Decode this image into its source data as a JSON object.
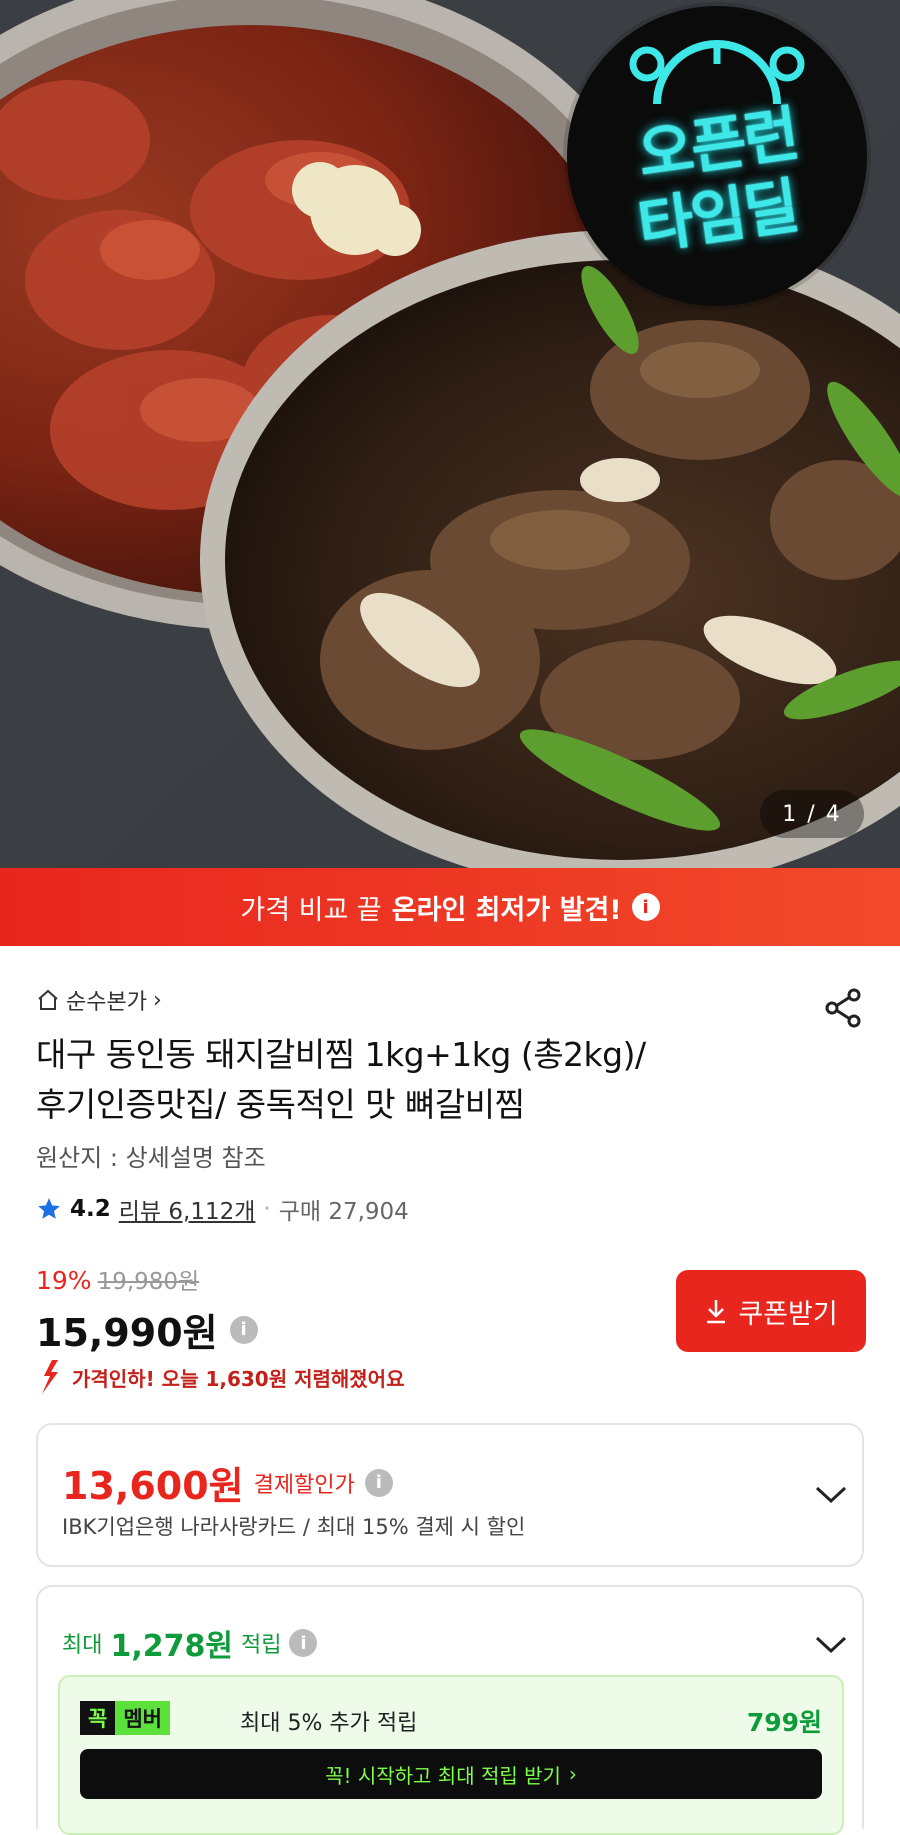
{
  "hero": {
    "badge_line1": "오픈런",
    "badge_line2": "타임딜",
    "pager": "1 / 4"
  },
  "banner": {
    "text_normal": "가격 비교 끝",
    "text_strong": "온라인 최저가 발견!",
    "info_glyph": "i"
  },
  "product": {
    "store_name": "순수본가",
    "store_chevron": "›",
    "title_line1": "대구 동인동 돼지갈비찜 1kg+1kg (총2kg)/",
    "title_line2": "후기인증맛집/ 중독적인 맛 뼈갈비찜",
    "origin": "원산지 : 상세설명 참조",
    "rating_score": "4.2",
    "review_label": "리뷰 6,112개",
    "separator": "·",
    "purchase_count": "구매 27,904"
  },
  "pricing": {
    "discount_pct": "19%",
    "original_price": "19,980원",
    "price": "15,990원",
    "price_info_glyph": "i",
    "coupon_label": "쿠폰받기",
    "price_drop_text": "가격인하! 오늘 1,630원 저렴해졌어요"
  },
  "payment_discount": {
    "amount": "13,600원",
    "label": "결제할인가",
    "info_glyph": "i",
    "description": "IBK기업은행 나라사랑카드 / 최대 15% 결제 시 할인"
  },
  "rewards": {
    "prefix": "최대",
    "amount": "1,278원",
    "suffix": "적립",
    "info_glyph": "i",
    "member_tag_1": "꼭",
    "member_tag_2": "멤버",
    "member_text": "최대 5% 추가 적립",
    "member_amount": "799원",
    "start_button": "꼭! 시작하고 최대 적립 받기",
    "start_chevron": "›"
  },
  "colors": {
    "accent_red": "#e8261e",
    "reward_green": "#0e9b3a",
    "neon_cyan": "#3ee8e8",
    "rating_star": "#1f6fe5"
  }
}
